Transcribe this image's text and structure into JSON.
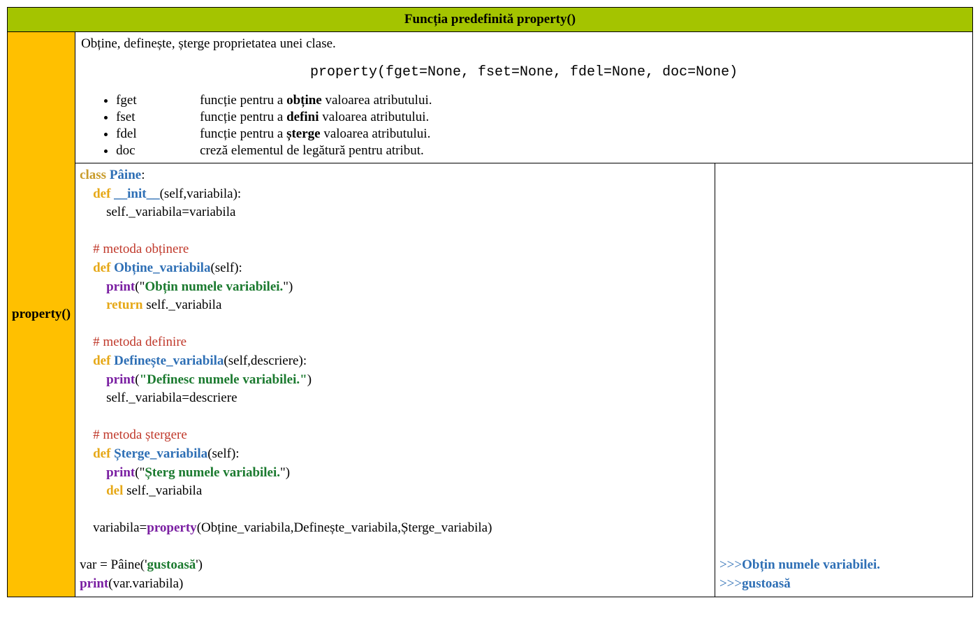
{
  "header": {
    "title": "Funcția predefinită property()"
  },
  "label": "property()",
  "description": {
    "intro": "Obține, definește, șterge proprietatea unei clase.",
    "signature": "property(fget=None, fset=None, fdel=None, doc=None)",
    "params": [
      {
        "name": "fget",
        "pre": "funcție pentru a ",
        "bold": "obține",
        "post": " valoarea atributului."
      },
      {
        "name": "fset",
        "pre": "funcție pentru a ",
        "bold": "defini",
        "post": " valoarea atributului."
      },
      {
        "name": "fdel",
        "pre": "funcție pentru a ",
        "bold": "șterge",
        "post": " valoarea atributului."
      },
      {
        "name": "doc",
        "pre": "",
        "bold": "",
        "post": "creză elementul de legătură pentru atribut."
      }
    ]
  },
  "code": {
    "l01a": "class",
    "l01b": "Pâine",
    "l01c": ":",
    "l02a": "def",
    "l02b": "__init__",
    "l02c": "(self,variabila):",
    "l03": "self._variabila=variabila",
    "c1": "# metoda obținere",
    "l05a": "def",
    "l05b": "Obține_variabila",
    "l05c": "(self):",
    "l06a": "print",
    "l06b": "(\"",
    "l06c": "Obțin numele variabilei.",
    "l06d": "\")",
    "l07a": "return",
    "l07b": " self._variabila",
    "c2": "# metoda definire",
    "l09a": "def",
    "l09b": "Definește_variabila",
    "l09c": "(self,descriere):",
    "l10a": "print",
    "l10b": "(",
    "l10c": "\"Definesc numele variabilei.\"",
    "l10d": ")",
    "l11": "self._variabila=descriere",
    "c3": "# metoda ștergere",
    "l13a": "def",
    "l13b": "Șterge_variabila",
    "l13c": "(self):",
    "l14a": "print",
    "l14b": "(\"",
    "l14c": "Șterg numele variabilei.",
    "l14d": "\")",
    "l15a": "del",
    "l15b": " self._variabila",
    "l17a": "variabila=",
    "l17b": "property",
    "l17c": "(Obține_variabila,Definește_variabila,Șterge_variabila)",
    "l19a": "var = Pâine('",
    "l19b": "gustoasă",
    "l19c": "')",
    "l20a": "print",
    "l20b": "(var.variabila)"
  },
  "output": {
    "p1": ">>>",
    "o1": "Obțin numele variabilei.",
    "p2": ">>>",
    "o2": "gustoasă"
  }
}
